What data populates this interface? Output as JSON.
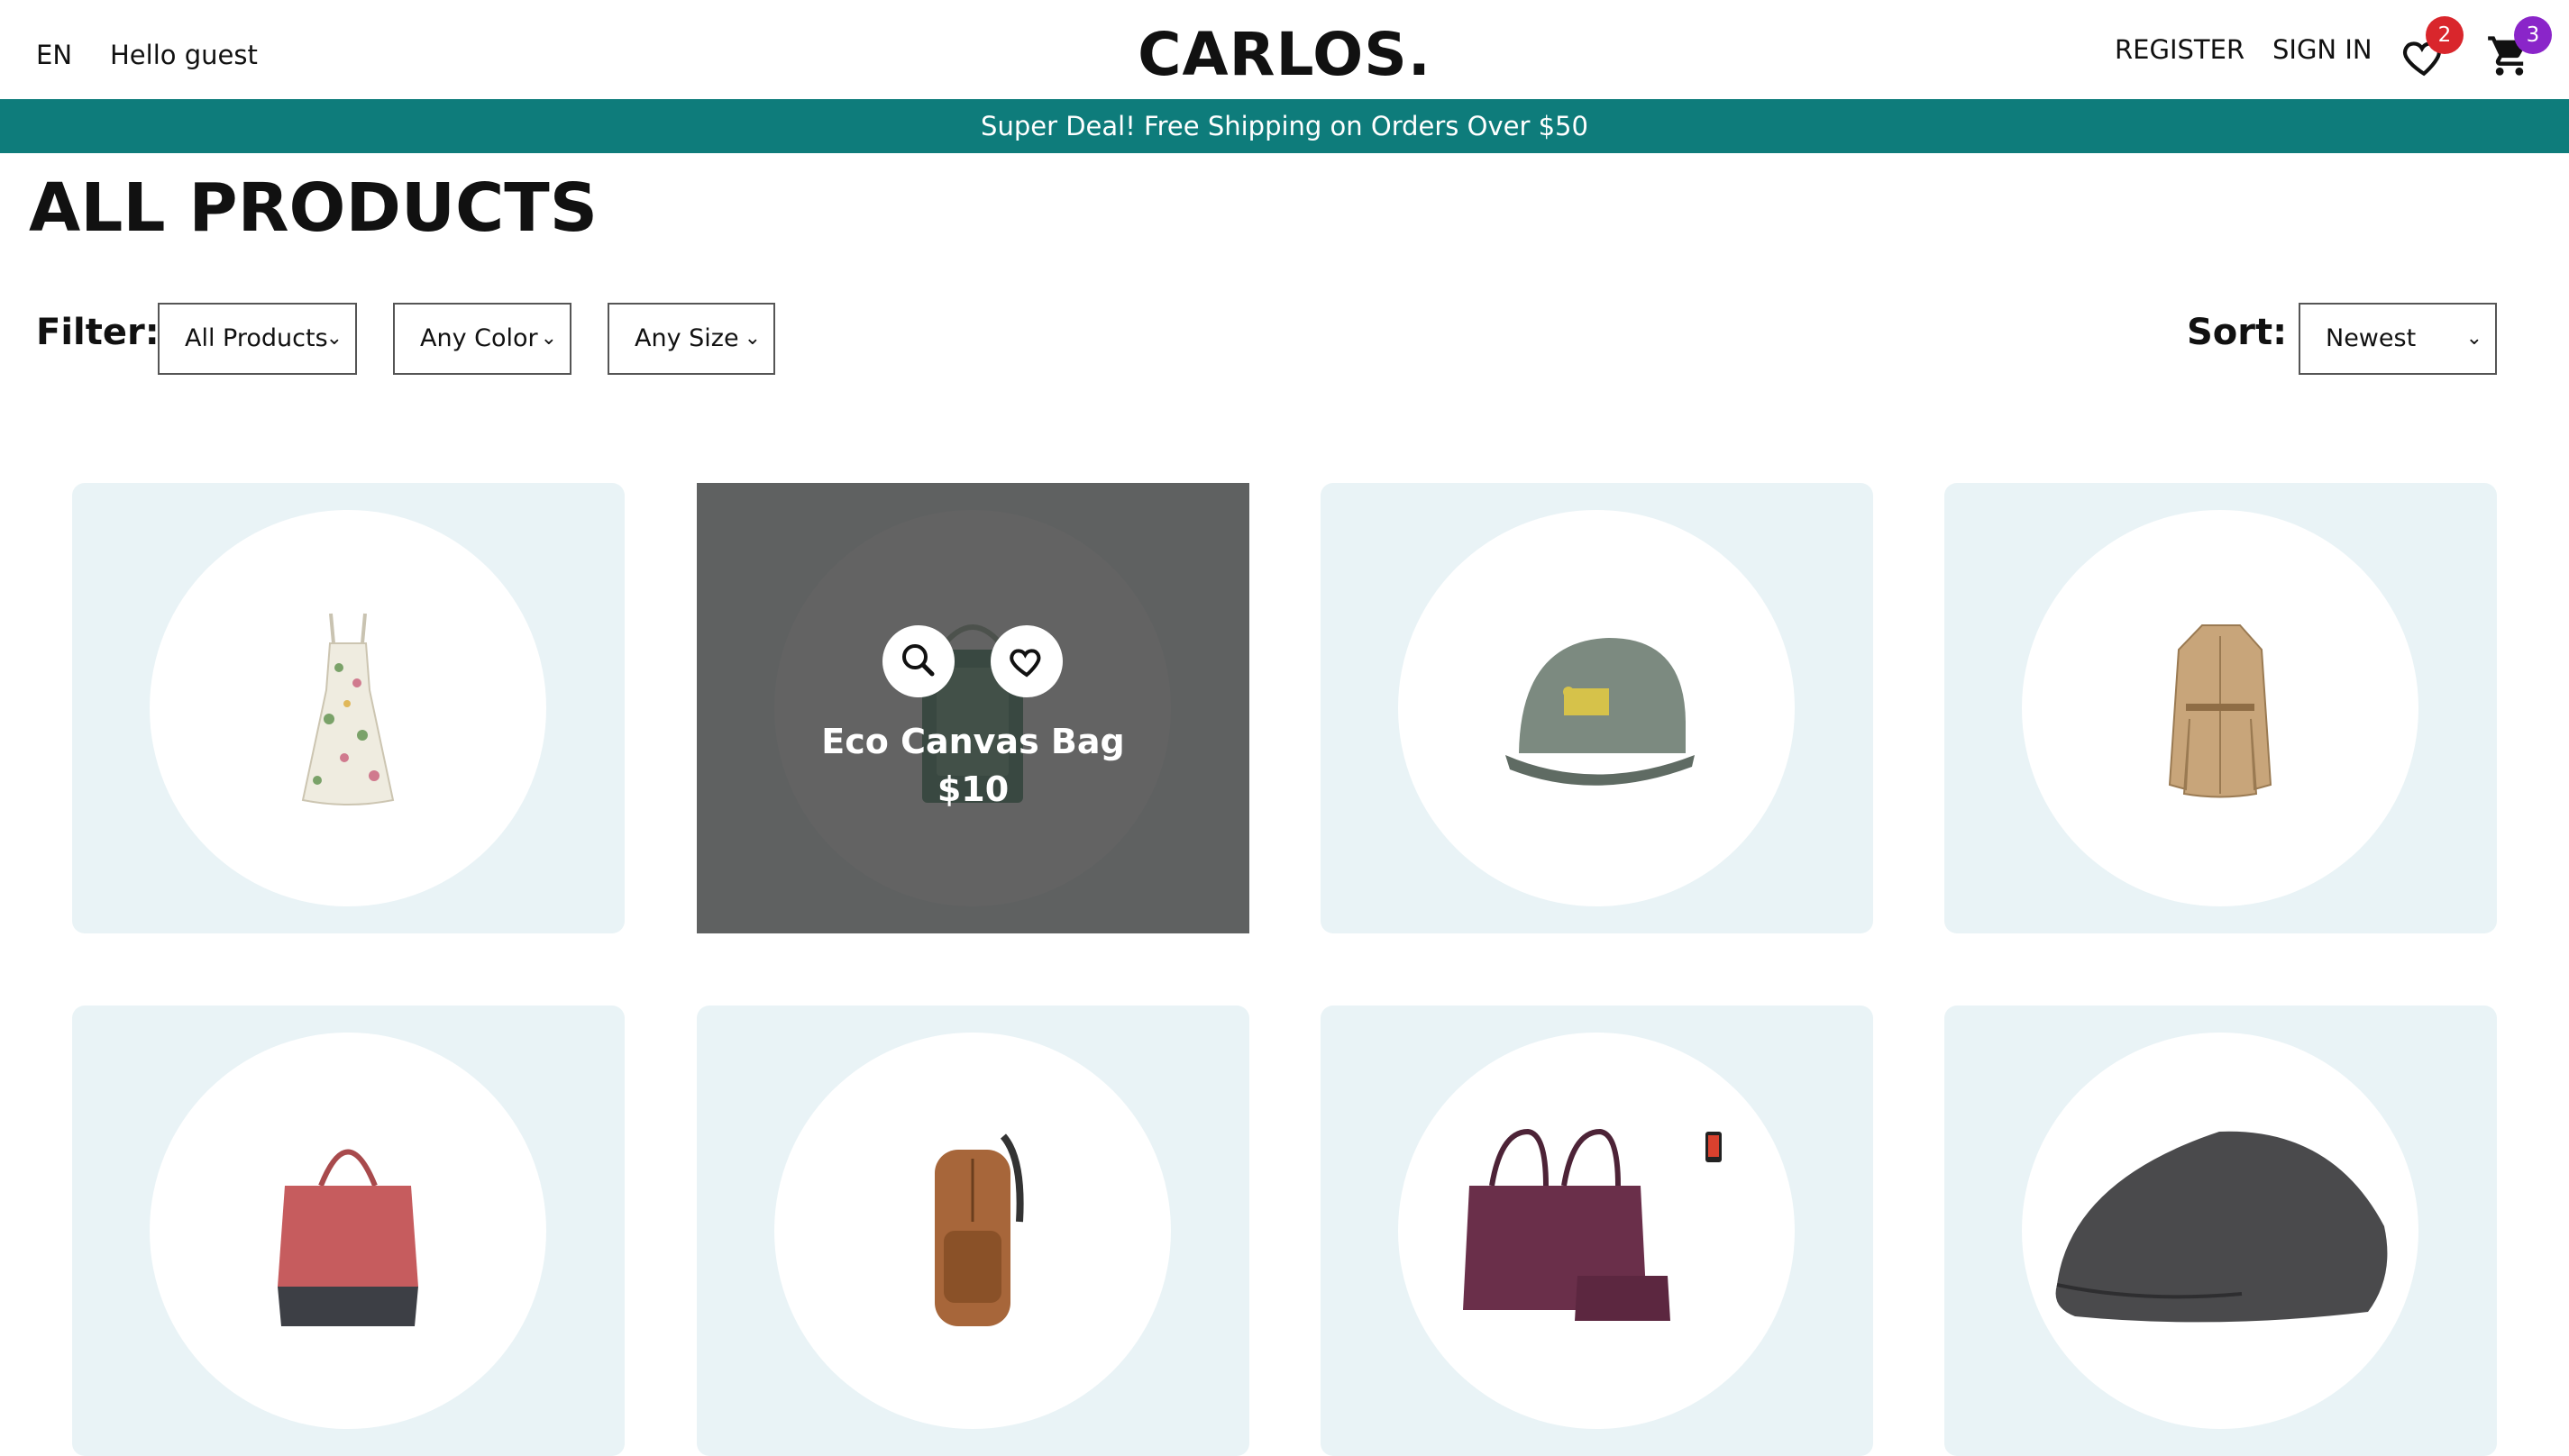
{
  "header": {
    "language": "EN",
    "greeting": "Hello guest",
    "logo": "CARLOS.",
    "register_label": "REGISTER",
    "signin_label": "SIGN IN",
    "wishlist_count": "2",
    "cart_count": "3",
    "icons": {
      "wishlist": "heart-icon",
      "cart": "cart-icon"
    }
  },
  "announcement": "Super Deal! Free Shipping on Orders Over $50",
  "page_title": "ALL PRODUCTS",
  "filters": {
    "label": "Filter:",
    "category": "All Products",
    "color": "Any Color",
    "size": "Any Size"
  },
  "sort": {
    "label": "Sort:",
    "value": "Newest"
  },
  "products": [
    {
      "image": "floral-dress"
    },
    {
      "image": "canvas-tote-bag",
      "name": "Eco Canvas Bag",
      "price": "$10",
      "hovered": true
    },
    {
      "image": "green-baseball-cap"
    },
    {
      "image": "beige-trench-coat"
    },
    {
      "image": "red-tote-bag"
    },
    {
      "image": "brown-leather-backpack"
    },
    {
      "image": "purple-laptop-handbag"
    },
    {
      "image": "grey-flat-cap"
    }
  ],
  "colors": {
    "accent": "#0e7c7b",
    "card_bg": "#e9f3f6",
    "wish_badge": "#d9262c",
    "cart_badge": "#8a25c9"
  }
}
